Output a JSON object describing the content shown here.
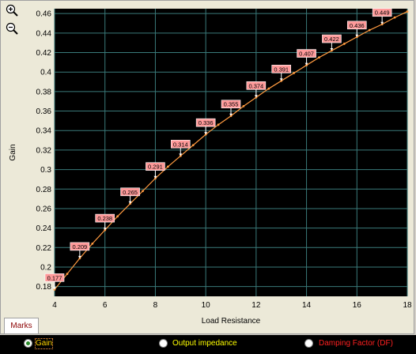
{
  "toolbar": {
    "zoom_in_icon": "zoom-in-magnifier-icon",
    "zoom_out_icon": "zoom-out-magnifier-icon"
  },
  "tabs": {
    "marks_label": "Marks"
  },
  "radio_options": [
    {
      "label": "Gain",
      "selected": true,
      "color": "#ffd700"
    },
    {
      "label": "Output impedance",
      "selected": false,
      "color": "#ffff00"
    },
    {
      "label": "Damping Factor (DF)",
      "selected": false,
      "color": "#ff2020"
    }
  ],
  "colors": {
    "plot_bg": "#000000",
    "grid": "#3a7a7a",
    "line": "#ff9a40",
    "marker_label_bg": "#ff9a9a"
  },
  "chart_data": {
    "type": "line",
    "title": "",
    "xlabel": "Load Resistance",
    "ylabel": "Gain",
    "xlim": [
      4,
      18
    ],
    "ylim": [
      0.17,
      0.465
    ],
    "xticks": [
      4,
      6,
      8,
      10,
      12,
      14,
      16,
      18
    ],
    "yticks": [
      0.18,
      0.2,
      0.22,
      0.24,
      0.26,
      0.28,
      0.3,
      0.32,
      0.34,
      0.36,
      0.38,
      0.4,
      0.42,
      0.44,
      0.46
    ],
    "grid": true,
    "series": [
      {
        "x": [
          4,
          4.5,
          5,
          5.5,
          6,
          6.5,
          7,
          7.5,
          8,
          8.5,
          9,
          9.5,
          10,
          10.5,
          11,
          11.5,
          12,
          12.5,
          13,
          13.5,
          14,
          14.5,
          15,
          15.5,
          16,
          16.5,
          17,
          17.5,
          18
        ],
        "y": [
          0.177,
          0.193,
          0.209,
          0.224,
          0.238,
          0.252,
          0.265,
          0.278,
          0.291,
          0.303,
          0.314,
          0.325,
          0.336,
          0.346,
          0.355,
          0.365,
          0.374,
          0.383,
          0.391,
          0.399,
          0.407,
          0.415,
          0.422,
          0.429,
          0.436,
          0.443,
          0.449,
          0.456,
          0.462
        ]
      }
    ],
    "annotations": [
      {
        "x": 4,
        "y": 0.177,
        "label": "0.177"
      },
      {
        "x": 5,
        "y": 0.209,
        "label": "0.209"
      },
      {
        "x": 6,
        "y": 0.238,
        "label": "0.238"
      },
      {
        "x": 7,
        "y": 0.265,
        "label": "0.265"
      },
      {
        "x": 8,
        "y": 0.291,
        "label": "0.291"
      },
      {
        "x": 9,
        "y": 0.314,
        "label": "0.314"
      },
      {
        "x": 10,
        "y": 0.336,
        "label": "0.336"
      },
      {
        "x": 11,
        "y": 0.355,
        "label": "0.355"
      },
      {
        "x": 12,
        "y": 0.374,
        "label": "0.374"
      },
      {
        "x": 13,
        "y": 0.391,
        "label": "0.391"
      },
      {
        "x": 14,
        "y": 0.407,
        "label": "0.407"
      },
      {
        "x": 15,
        "y": 0.422,
        "label": "0.422"
      },
      {
        "x": 16,
        "y": 0.436,
        "label": "0.436"
      },
      {
        "x": 17,
        "y": 0.449,
        "label": "0.449"
      }
    ]
  }
}
